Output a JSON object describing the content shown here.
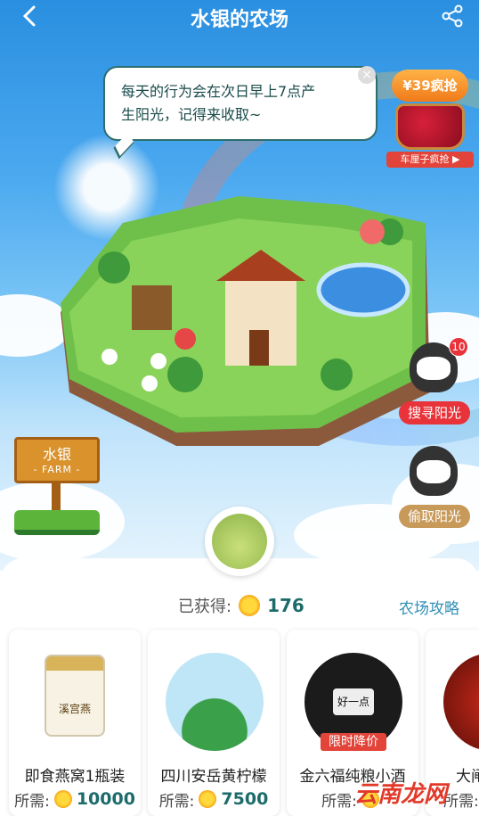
{
  "header": {
    "title": "水银的农场"
  },
  "bubble": {
    "text_line1": "每天的行为会在次日早上7点产",
    "text_line2": "生阳光，记得来收取~"
  },
  "promo": {
    "price": "¥39疯抢",
    "caption": "车厘子疯抢 ▶"
  },
  "farm_sign": {
    "name": "水银",
    "sub": "- FARM -"
  },
  "side_actions": [
    {
      "label": "搜寻阳光",
      "badge": "10",
      "color": "#e8333a"
    },
    {
      "label": "偷取阳光",
      "color": "#c89a5a"
    }
  ],
  "stats": {
    "earned_label": "已获得:",
    "earned_value": "176",
    "guide_label": "农场攻略"
  },
  "cards": [
    {
      "name": "即食燕窝1瓶装",
      "price_label": "所需:",
      "price": "10000",
      "jar_text": "溪宫燕"
    },
    {
      "name": "四川安岳黄柠檬",
      "price_label": "所需:",
      "price": "7500"
    },
    {
      "name": "金六福纯粮小酒",
      "price_label": "所需:",
      "price": "",
      "tag": "限时降价",
      "bottle_text": "好一点"
    },
    {
      "name": "大闸",
      "price_label": "所需:"
    }
  ],
  "watermark": "云南龙网",
  "colors": {
    "accent": "#1d6b6b",
    "link": "#2f8fb6",
    "sky": "#4aa8ef"
  }
}
